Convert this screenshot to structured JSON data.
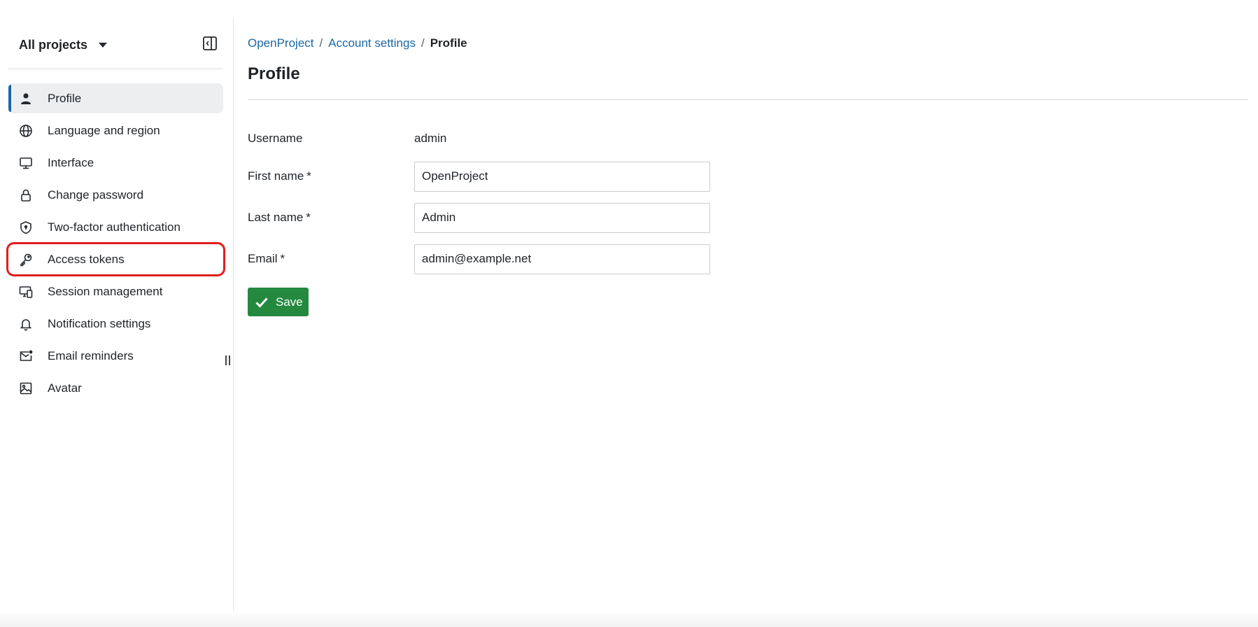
{
  "sidebar": {
    "project_selector": "All projects",
    "items": [
      {
        "label": "Profile",
        "icon": "person-icon"
      },
      {
        "label": "Language and region",
        "icon": "globe-icon"
      },
      {
        "label": "Interface",
        "icon": "monitor-icon"
      },
      {
        "label": "Change password",
        "icon": "lock-icon"
      },
      {
        "label": "Two-factor authentication",
        "icon": "shield-icon"
      },
      {
        "label": "Access tokens",
        "icon": "key-icon"
      },
      {
        "label": "Session management",
        "icon": "devices-icon"
      },
      {
        "label": "Notification settings",
        "icon": "bell-icon"
      },
      {
        "label": "Email reminders",
        "icon": "mail-icon"
      },
      {
        "label": "Avatar",
        "icon": "image-icon"
      }
    ],
    "active_item": "Profile",
    "highlighted_item": "Access tokens",
    "highlight_color": "#e01e1e",
    "active_color": "#1a67a3"
  },
  "breadcrumb": {
    "root": "OpenProject",
    "parent": "Account settings",
    "current": "Profile",
    "separator": "/"
  },
  "page": {
    "title": "Profile"
  },
  "form": {
    "username_label": "Username",
    "username_value": "admin",
    "first_name_label": "First name",
    "first_name_value": "OpenProject",
    "last_name_label": "Last name",
    "last_name_value": "Admin",
    "email_label": "Email",
    "email_value": "admin@example.net",
    "required_marker": "*",
    "save_label": "Save",
    "save_color": "#24893f"
  }
}
